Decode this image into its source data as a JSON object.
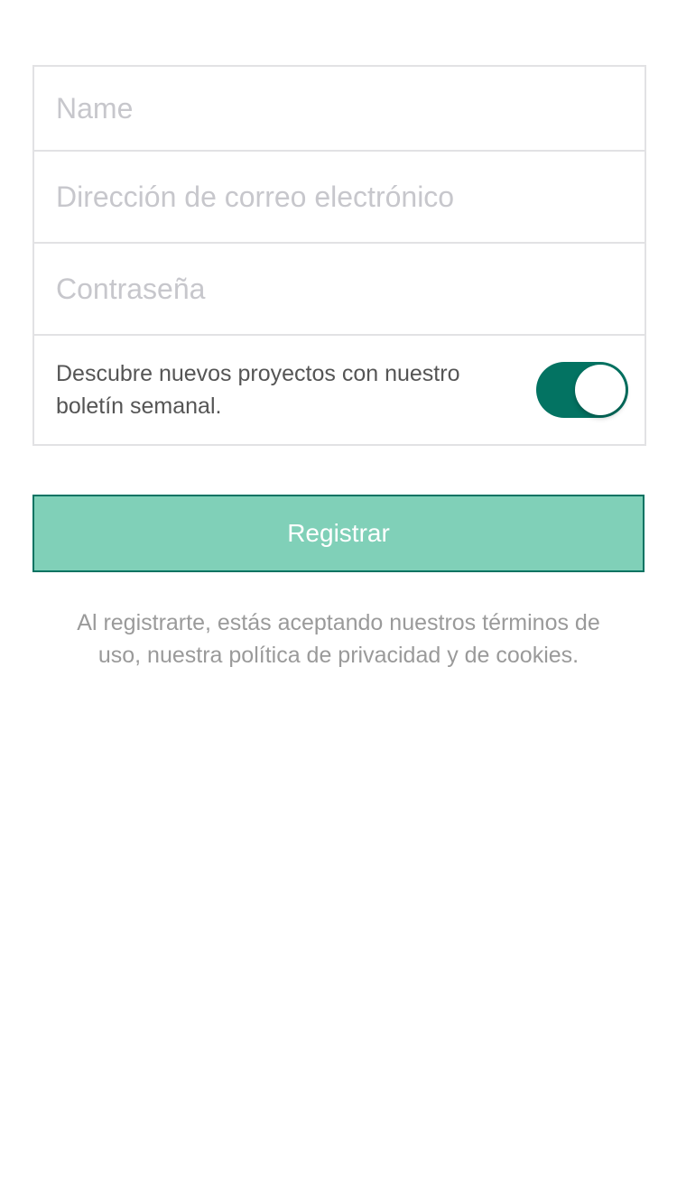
{
  "form": {
    "name": {
      "value": "",
      "placeholder": "Name"
    },
    "email": {
      "value": "",
      "placeholder": "Dirección de correo electrónico"
    },
    "password": {
      "value": "",
      "placeholder": "Contraseña"
    },
    "newsletter": {
      "label": "Descubre nuevos proyectos con nuestro boletín semanal.",
      "enabled": true
    }
  },
  "register_button": {
    "label": "Registrar"
  },
  "legal_text": "Al registrarte, estás aceptando nuestros términos de uso, nuestra política de privacidad y de cookies.",
  "colors": {
    "accent": "#037362",
    "button_fill": "#80d0b8",
    "placeholder": "#c7c7cc",
    "border": "#e2e2e4",
    "legal_text": "#9a9a9a"
  }
}
